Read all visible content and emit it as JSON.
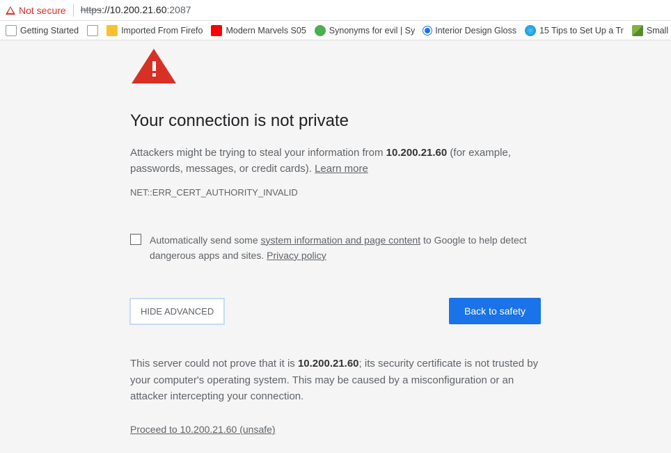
{
  "address_bar": {
    "security_label": "Not secure",
    "url_scheme": "https",
    "url_sep": "://",
    "url_host": "10.200.21.60",
    "url_port_text": ":2087"
  },
  "bookmarks": [
    {
      "label": "Getting Started",
      "icon": "page"
    },
    {
      "label": "",
      "icon": "page"
    },
    {
      "label": "Imported From Firefo",
      "icon": "folder"
    },
    {
      "label": "Modern Marvels S05",
      "icon": "youtube"
    },
    {
      "label": "Synonyms for evil | Sy",
      "icon": "green"
    },
    {
      "label": "Interior Design Gloss",
      "icon": "olive"
    },
    {
      "label": "15 Tips to Set Up a Tr",
      "icon": "tips"
    },
    {
      "label": "Small Bathr",
      "icon": "houzz"
    }
  ],
  "page": {
    "heading": "Your connection is not private",
    "body_prefix": "Attackers might be trying to steal your information from ",
    "body_host": "10.200.21.60",
    "body_suffix": " (for example, passwords, messages, or credit cards). ",
    "learn_more": "Learn more",
    "error_code": "NET::ERR_CERT_AUTHORITY_INVALID",
    "ssr_prefix": "Automatically send some ",
    "ssr_link1": "system information and page content",
    "ssr_mid": " to Google to help detect dangerous apps and sites. ",
    "ssr_link2": "Privacy policy",
    "hide_advanced": "HIDE ADVANCED",
    "back_to_safety": "Back to safety",
    "advanced_prefix": "This server could not prove that it is ",
    "advanced_host": "10.200.21.60",
    "advanced_suffix": "; its security certificate is not trusted by your computer's operating system. This may be caused by a misconfiguration or an attacker intercepting your connection.",
    "proceed": "Proceed to 10.200.21.60 (unsafe)"
  }
}
